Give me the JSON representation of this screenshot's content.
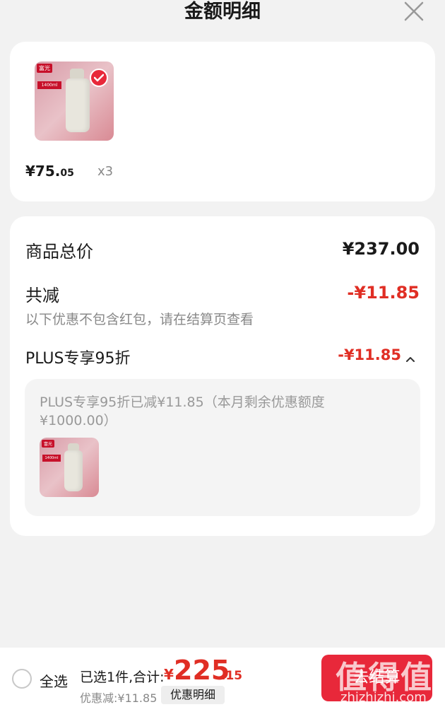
{
  "header": {
    "title": "金额明细"
  },
  "product": {
    "brand": "富光",
    "spec": "1400ml",
    "price_main": "¥75.",
    "price_cents": "05",
    "quantity": "x3",
    "selected": true
  },
  "summary": {
    "total_label": "商品总价",
    "total_value": "¥237.00",
    "discount_label": "共减",
    "discount_value": "-¥11.85",
    "discount_note": "以下优惠不包含红包，请在结算页查看",
    "plus_label": "PLUS专享95折",
    "plus_value": "-¥11.85",
    "plus_detail": "PLUS专享95折已减¥11.85（本月剩余优惠额度¥1000.00）"
  },
  "bottom": {
    "select_all": "全选",
    "selected_info": "已选1件,合计:",
    "currency": "¥",
    "total_main": "225",
    "total_cents": ".15",
    "discount_line": "优惠减:¥11.85",
    "detail_button": "优惠明细",
    "checkout_button": "去结算",
    "watermark": "值得值",
    "watermark_url": "zhizhizhi.com"
  },
  "colors": {
    "accent": "#e02e24",
    "checkout": "#e8283a",
    "background": "#f2f2f2"
  },
  "icons": {
    "close": "close-icon",
    "check": "check-icon",
    "chevron": "chevron-up-icon"
  }
}
